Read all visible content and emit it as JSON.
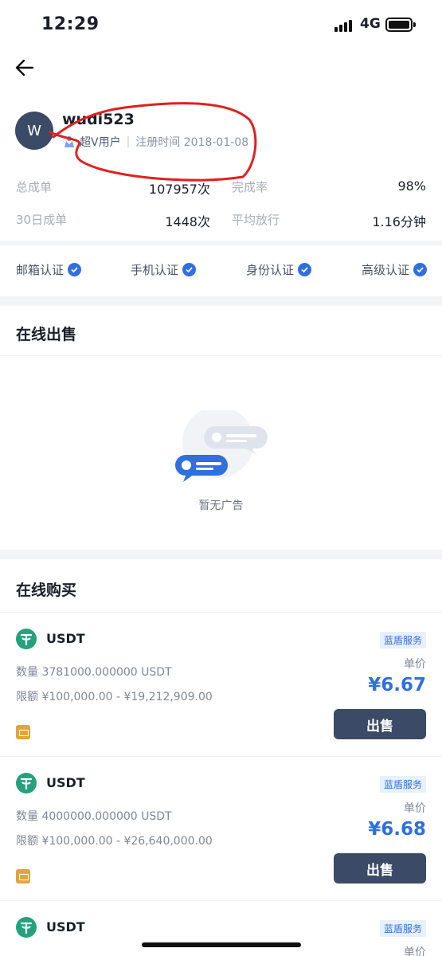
{
  "status_bar": {
    "time": "12:29",
    "network": "4G"
  },
  "profile": {
    "avatar_letter": "W",
    "username": "wudi523",
    "user_type": "超V用户",
    "separator": "|",
    "register_label": "注册时间 2018-01-08"
  },
  "stats": [
    {
      "label": "总成单",
      "value": "107957次"
    },
    {
      "label": "完成率",
      "value": "98%"
    },
    {
      "label": "30日成单",
      "value": "1448次"
    },
    {
      "label": "平均放行",
      "value": "1.16分钟"
    }
  ],
  "verifications": [
    "邮箱认证",
    "手机认证",
    "身份认证",
    "高级认证"
  ],
  "sell_section": {
    "title": "在线出售",
    "empty_text": "暂无广告"
  },
  "buy_section": {
    "title": "在线购买",
    "items": [
      {
        "coin": "USDT",
        "badge": "蓝盾服务",
        "quantity": "数量 3781000.000000 USDT",
        "limit": "限额 ¥100,000.00 - ¥19,212,909.00",
        "unit_label": "单价",
        "price": "¥6.67",
        "action": "出售"
      },
      {
        "coin": "USDT",
        "badge": "蓝盾服务",
        "quantity": "数量 4000000.000000 USDT",
        "limit": "限额 ¥100,000.00 - ¥26,640,000.00",
        "unit_label": "单价",
        "price": "¥6.68",
        "action": "出售"
      },
      {
        "coin": "USDT",
        "badge": "蓝盾服务",
        "unit_label": "单价"
      }
    ]
  },
  "colors": {
    "accent": "#2f6fe0",
    "button": "#3b4a66",
    "tether": "#26a17b",
    "annotation": "#e02020"
  },
  "icons": [
    "back-arrow-icon",
    "super-v-icon",
    "verified-check-icon",
    "tether-icon",
    "payment-card-icon",
    "empty-chat-icon"
  ]
}
